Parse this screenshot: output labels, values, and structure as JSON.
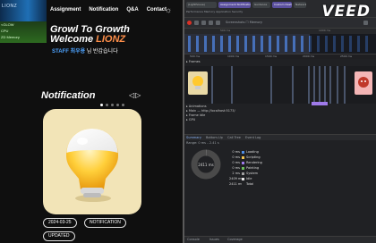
{
  "site": {
    "logo_text": "LIONZ",
    "nav": [
      "Assignment",
      "Notification",
      "Q&A",
      "Contact"
    ],
    "overlay_lines": [
      "<GLOW",
      "CPU",
      "ZD Memory"
    ],
    "hero_line1": "Growl To Growth",
    "hero_line2_prefix": "Welcome ",
    "hero_line2_accent": "LIONZ",
    "staff_label": "STAFF",
    "staff_name": "최우용",
    "greeting": "님 반갑습니다",
    "section_title": "Notification",
    "arrows": "◁▷",
    "date": "2024-03-25",
    "category_tag": "NOTIFICATION",
    "badge": "UPDATED",
    "colors": {
      "accent": "#ff8f4a",
      "staff": "#4ea3ff",
      "card": "#f2e4b7"
    }
  },
  "devtools": {
    "tabs": [
      "(Lighthouse)",
      "Assignment Notification",
      "Guidance",
      "Custom Dashboard",
      "Network"
    ],
    "row2": "Performance   Memory   Application   Security",
    "brand": "VEED",
    "toolbar_label": "Screenshots  ☐ Memory",
    "ruler_left": "500 ms",
    "ruler_right": "1000 ms",
    "ms_marks": [
      "500 ms",
      "1000 ms",
      "1500 ms",
      "2000 ms",
      "2500 ms"
    ],
    "frames_label": "▸ Frames",
    "flame_rows": [
      "▸ Animations",
      "▸ Main — http://localhost:5173/",
      "▸ Frame Idle",
      "▸ GPU"
    ],
    "bottom_tabs": [
      "Summary",
      "Bottom-Up",
      "Call Tree",
      "Event Log"
    ],
    "range_label": "Range: 0 ms – 2.41 s",
    "total": "2411 ms",
    "summary": [
      {
        "ms": "0 ms",
        "name": "Loading",
        "color": "#4e8ee6"
      },
      {
        "ms": "0 ms",
        "name": "Scripting",
        "color": "#f0c24d"
      },
      {
        "ms": "0 ms",
        "name": "Rendering",
        "color": "#9f7aea"
      },
      {
        "ms": "0 ms",
        "name": "Painting",
        "color": "#6bbe5a"
      },
      {
        "ms": "2 ms",
        "name": "System",
        "color": "#a0a0a0"
      },
      {
        "ms": "2409 ms",
        "name": "Idle",
        "color": "#e4e4e4"
      },
      {
        "ms": "2411 ms",
        "name": "Total",
        "color": "#202124"
      }
    ],
    "status_items": [
      "Console",
      "Issues",
      "Coverage"
    ]
  }
}
